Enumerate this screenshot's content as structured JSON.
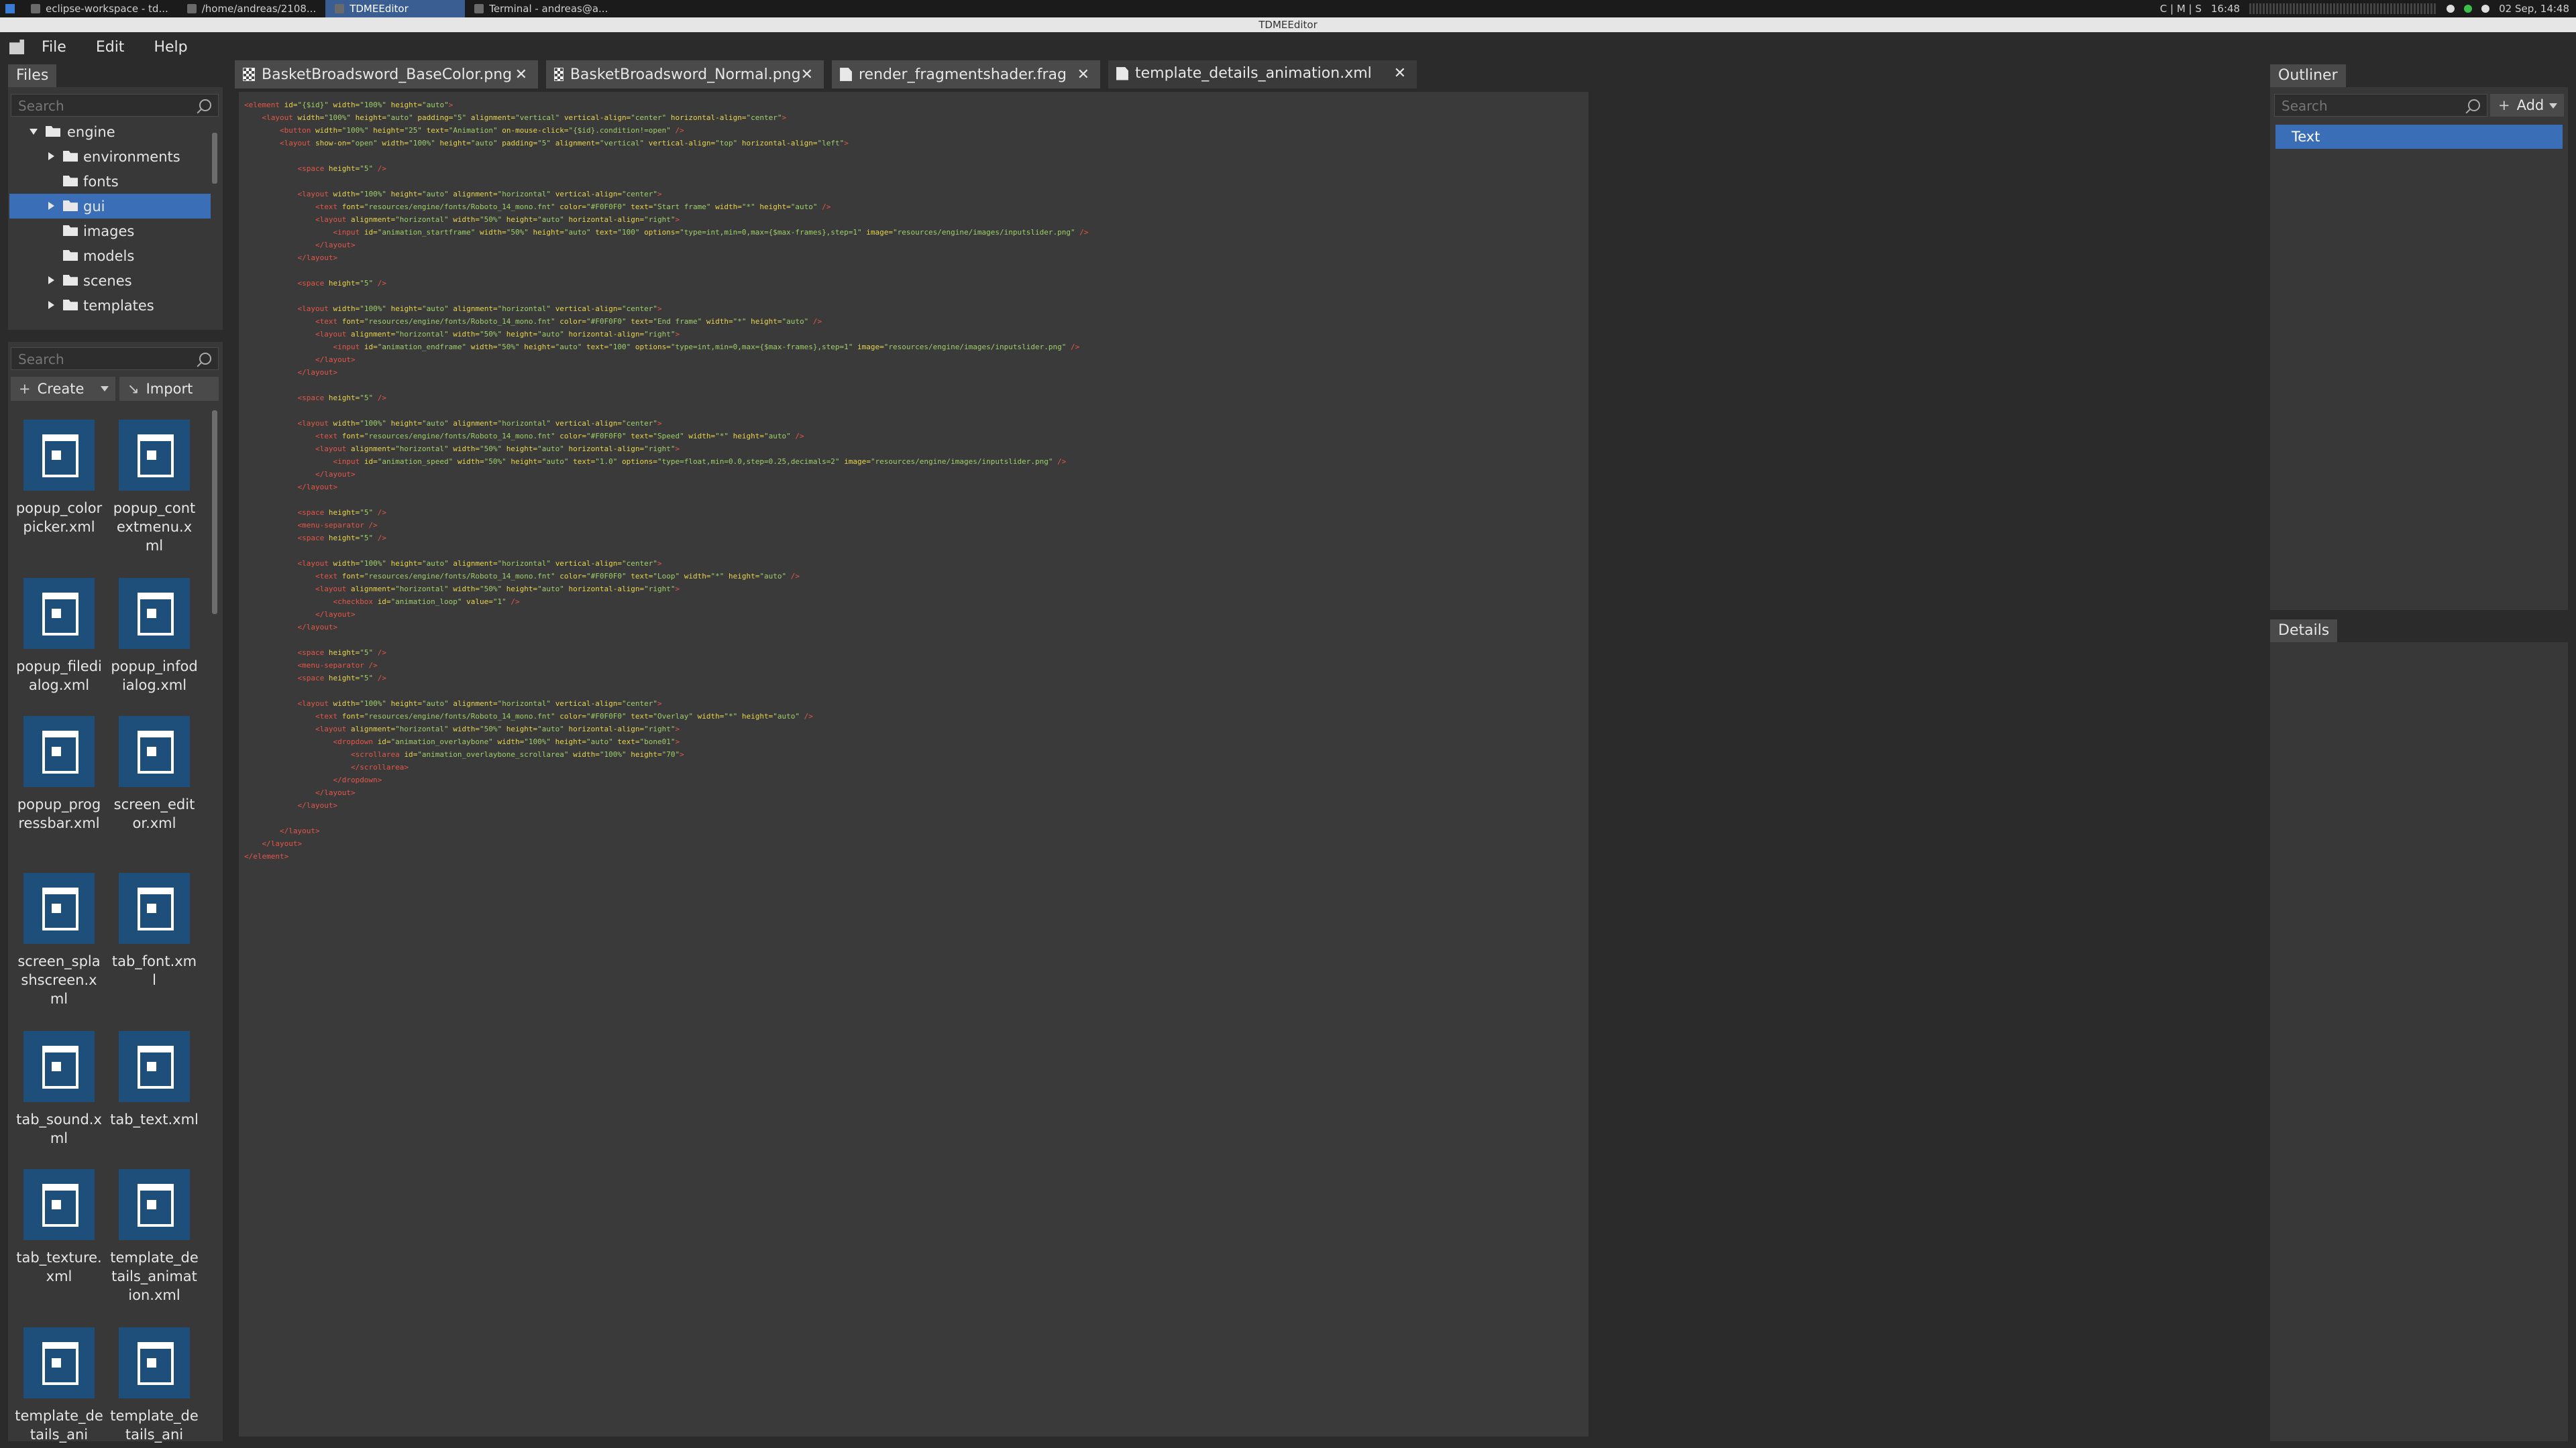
{
  "taskbar": {
    "items": [
      {
        "label": "eclipse-workspace - td..."
      },
      {
        "label": "/home/andreas/2108..."
      },
      {
        "label": "TDMEEditor"
      },
      {
        "label": "Terminal - andreas@a..."
      }
    ],
    "tray_status": "C | M | S",
    "time": "16:48",
    "date": "02 Sep, 14:48"
  },
  "window": {
    "title": "TDMEEditor"
  },
  "menu": {
    "items": [
      "File",
      "Edit",
      "Help"
    ]
  },
  "files_panel": {
    "tab_label": "Files",
    "search_placeholder": "Search",
    "tree": [
      {
        "label": "engine",
        "level": 0,
        "expander": "down",
        "selected": false
      },
      {
        "label": "environments",
        "level": 1,
        "expander": "right",
        "selected": false
      },
      {
        "label": "fonts",
        "level": 1,
        "expander": "none",
        "selected": false
      },
      {
        "label": "gui",
        "level": 1,
        "expander": "right",
        "selected": true
      },
      {
        "label": "images",
        "level": 1,
        "expander": "none",
        "selected": false
      },
      {
        "label": "models",
        "level": 1,
        "expander": "none",
        "selected": false
      },
      {
        "label": "scenes",
        "level": 1,
        "expander": "right",
        "selected": false
      },
      {
        "label": "templates",
        "level": 1,
        "expander": "right",
        "selected": false
      }
    ],
    "search2_placeholder": "Search",
    "create_label": "Create",
    "import_label": "Import",
    "files": [
      "popup_colorpicker.xml",
      "popup_contextmenu.xml",
      "popup_filedialog.xml",
      "popup_infodialog.xml",
      "popup_progressbar.xml",
      "screen_editor.xml",
      "screen_splashscreen.xml",
      "tab_font.xml",
      "tab_sound.xml",
      "tab_text.xml",
      "tab_texture.xml",
      "template_details_animation.xml",
      "template_details_ani",
      "template_details_ani"
    ]
  },
  "editor": {
    "tabs": [
      {
        "label": "BasketBroadsword_BaseColor.png",
        "icon": "image-icon",
        "active": false
      },
      {
        "label": "BasketBroadsword_Normal.png",
        "icon": "image-icon",
        "active": false
      },
      {
        "label": "render_fragmentshader.frag",
        "icon": "document-icon",
        "active": false
      },
      {
        "label": "template_details_animation.xml",
        "icon": "document-icon",
        "active": true
      }
    ],
    "code_lines": [
      "<element id=\"{$id}\" width=\"100%\" height=\"auto\">",
      "    <layout width=\"100%\" height=\"auto\" padding=\"5\" alignment=\"vertical\" vertical-align=\"center\" horizontal-align=\"center\">",
      "        <button width=\"100%\" height=\"25\" text=\"Animation\" on-mouse-click=\"{$id}.condition!=open\" />",
      "        <layout show-on=\"open\" width=\"100%\" height=\"auto\" padding=\"5\" alignment=\"vertical\" vertical-align=\"top\" horizontal-align=\"left\">",
      "",
      "            <space height=\"5\" />",
      "",
      "            <layout width=\"100%\" height=\"auto\" alignment=\"horizontal\" vertical-align=\"center\">",
      "                <text font=\"resources/engine/fonts/Roboto_14_mono.fnt\" color=\"#F0F0F0\" text=\"Start frame\" width=\"*\" height=\"auto\" />",
      "                <layout alignment=\"horizontal\" width=\"50%\" height=\"auto\" horizontal-align=\"right\">",
      "                    <input id=\"animation_startframe\" width=\"50%\" height=\"auto\" text=\"100\" options=\"type=int,min=0,max={$max-frames},step=1\" image=\"resources/engine/images/inputslider.png\" />",
      "                </layout>",
      "            </layout>",
      "",
      "            <space height=\"5\" />",
      "",
      "            <layout width=\"100%\" height=\"auto\" alignment=\"horizontal\" vertical-align=\"center\">",
      "                <text font=\"resources/engine/fonts/Roboto_14_mono.fnt\" color=\"#F0F0F0\" text=\"End frame\" width=\"*\" height=\"auto\" />",
      "                <layout alignment=\"horizontal\" width=\"50%\" height=\"auto\" horizontal-align=\"right\">",
      "                    <input id=\"animation_endframe\" width=\"50%\" height=\"auto\" text=\"100\" options=\"type=int,min=0,max={$max-frames},step=1\" image=\"resources/engine/images/inputslider.png\" />",
      "                </layout>",
      "            </layout>",
      "",
      "            <space height=\"5\" />",
      "",
      "            <layout width=\"100%\" height=\"auto\" alignment=\"horizontal\" vertical-align=\"center\">",
      "                <text font=\"resources/engine/fonts/Roboto_14_mono.fnt\" color=\"#F0F0F0\" text=\"Speed\" width=\"*\" height=\"auto\" />",
      "                <layout alignment=\"horizontal\" width=\"50%\" height=\"auto\" horizontal-align=\"right\">",
      "                    <input id=\"animation_speed\" width=\"50%\" height=\"auto\" text=\"1.0\" options=\"type=float,min=0.0,step=0.25,decimals=2\" image=\"resources/engine/images/inputslider.png\" />",
      "                </layout>",
      "            </layout>",
      "",
      "            <space height=\"5\" />",
      "            <menu-separator />",
      "            <space height=\"5\" />",
      "",
      "            <layout width=\"100%\" height=\"auto\" alignment=\"horizontal\" vertical-align=\"center\">",
      "                <text font=\"resources/engine/fonts/Roboto_14_mono.fnt\" color=\"#F0F0F0\" text=\"Loop\" width=\"*\" height=\"auto\" />",
      "                <layout alignment=\"horizontal\" width=\"50%\" height=\"auto\" horizontal-align=\"right\">",
      "                    <checkbox id=\"animation_loop\" value=\"1\" />",
      "                </layout>",
      "            </layout>",
      "",
      "            <space height=\"5\" />",
      "            <menu-separator />",
      "            <space height=\"5\" />",
      "",
      "            <layout width=\"100%\" height=\"auto\" alignment=\"horizontal\" vertical-align=\"center\">",
      "                <text font=\"resources/engine/fonts/Roboto_14_mono.fnt\" color=\"#F0F0F0\" text=\"Overlay\" width=\"*\" height=\"auto\" />",
      "                <layout alignment=\"horizontal\" width=\"50%\" height=\"auto\" horizontal-align=\"right\">",
      "                    <dropdown id=\"animation_overlaybone\" width=\"100%\" height=\"auto\" text=\"bone01\">",
      "                        <scrollarea id=\"animation_overlaybone_scrollarea\" width=\"100%\" height=\"70\">",
      "                        </scrollarea>",
      "                    </dropdown>",
      "                </layout>",
      "            </layout>",
      "",
      "        </layout>",
      "    </layout>",
      "</element>"
    ]
  },
  "outliner": {
    "tab_label": "Outliner",
    "search_placeholder": "Search",
    "add_label": "Add",
    "items": [
      {
        "label": "Text",
        "selected": true
      }
    ]
  },
  "details": {
    "tab_label": "Details"
  },
  "colors": {
    "accent": "#3a6fb7",
    "tag": "#e45649",
    "attribute": "#e8d44d",
    "value": "#9fce6a",
    "file_icon_bg": "#1d4f7a"
  }
}
